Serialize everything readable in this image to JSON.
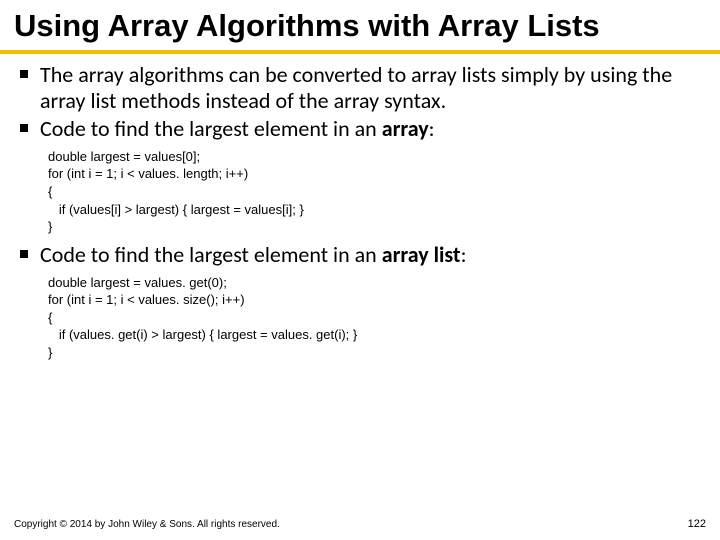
{
  "title": "Using Array Algorithms with Array Lists",
  "bullets": {
    "b1": "The array algorithms can be converted to array lists simply by using the array list methods instead of the array syntax.",
    "b2_prefix": "Code to find the largest element in an ",
    "b2_bold": "array",
    "b2_suffix": ":",
    "b3_prefix": "Code to find the largest element in an ",
    "b3_bold": "array list",
    "b3_suffix": ":"
  },
  "code": {
    "array": "double largest = values[0];\nfor (int i = 1; i < values. length; i++)\n{\n   if (values[i] > largest) { largest = values[i]; }\n}",
    "arraylist": "double largest = values. get(0);\nfor (int i = 1; i < values. size(); i++)\n{\n   if (values. get(i) > largest) { largest = values. get(i); }\n}"
  },
  "footer": {
    "copyright": "Copyright © 2014 by John Wiley & Sons. All rights reserved.",
    "page": "122"
  }
}
